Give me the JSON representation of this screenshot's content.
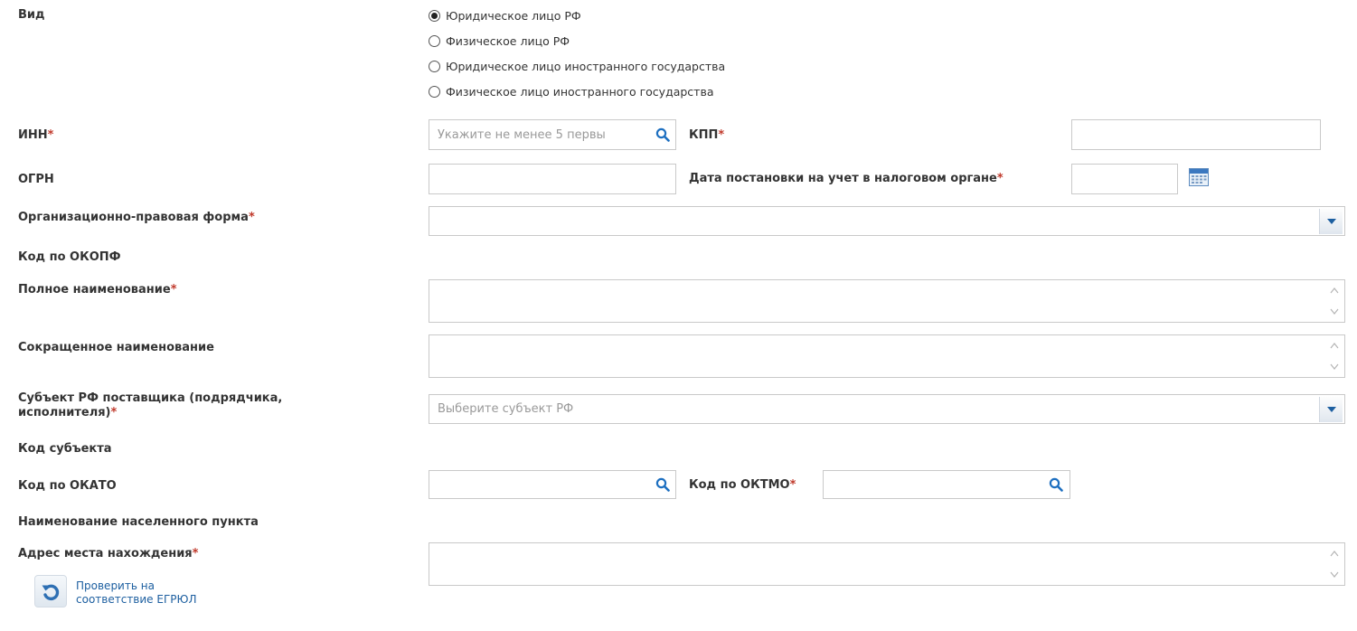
{
  "type_section": {
    "label": "Вид",
    "options": [
      {
        "label": "Юридическое лицо РФ",
        "checked": true
      },
      {
        "label": "Физическое лицо РФ",
        "checked": false
      },
      {
        "label": "Юридическое лицо иностранного государства",
        "checked": false
      },
      {
        "label": "Физическое лицо иностранного государства",
        "checked": false
      }
    ]
  },
  "inn": {
    "label": "ИНН",
    "required_mark": "*",
    "value": "",
    "placeholder": "Укажите не менее 5 первы"
  },
  "kpp": {
    "label": "КПП",
    "required_mark": "*",
    "value": ""
  },
  "ogrn": {
    "label": "ОГРН",
    "value": ""
  },
  "registration_date": {
    "label": "Дата постановки на учет в налоговом органе",
    "required_mark": "*",
    "value": ""
  },
  "org_form": {
    "label": "Организационно-правовая форма",
    "required_mark": "*",
    "value": ""
  },
  "okopf": {
    "label": "Код по ОКОПФ"
  },
  "full_name": {
    "label": "Полное наименование",
    "required_mark": "*",
    "value": ""
  },
  "short_name": {
    "label": "Сокращенное наименование",
    "value": ""
  },
  "subject": {
    "label_line1": "Субъект РФ поставщика (подрядчика,",
    "label_line2": "исполнителя)",
    "required_mark": "*",
    "placeholder": "Выберите субъект РФ"
  },
  "subject_code": {
    "label": "Код субъекта"
  },
  "okato": {
    "label": "Код по ОКАТО",
    "value": ""
  },
  "oktmo": {
    "label": "Код по ОКТМО",
    "required_mark": "*",
    "value": ""
  },
  "settlement": {
    "label": "Наименование населенного пункта"
  },
  "address": {
    "label": "Адрес места нахождения",
    "required_mark": "*",
    "value": ""
  },
  "verify": {
    "line1": "Проверить на",
    "line2": "соответствие ЕГРЮЛ"
  },
  "colors": {
    "accent": "#1d6fc0",
    "required": "#c0392b"
  }
}
